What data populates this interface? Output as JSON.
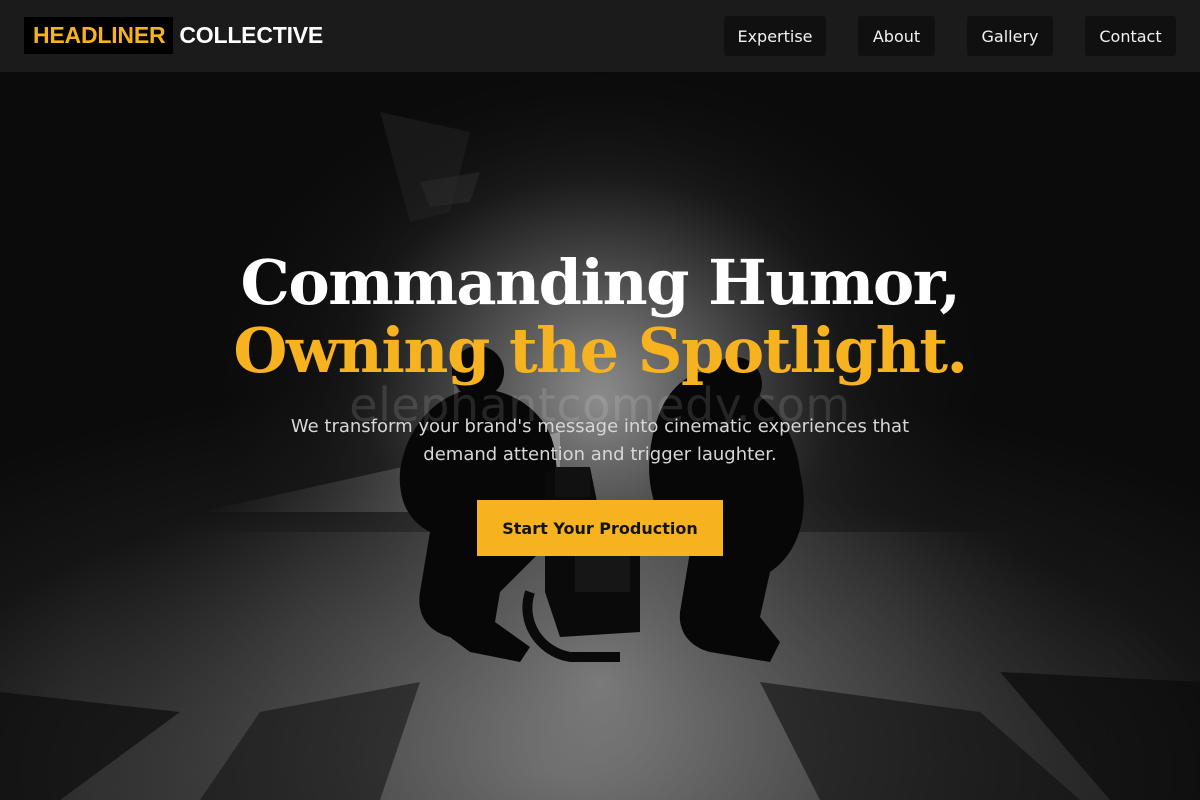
{
  "brand": {
    "primary": "HEADLINER",
    "secondary": "COLLECTIVE"
  },
  "nav": {
    "items": [
      {
        "label": "Expertise"
      },
      {
        "label": "About"
      },
      {
        "label": "Gallery"
      },
      {
        "label": "Contact"
      }
    ]
  },
  "hero": {
    "headline_line1": "Commanding Humor,",
    "headline_line2": "Owning the Spotlight.",
    "watermark": "elephantcomedy.com",
    "subcopy": "We transform your brand's message into cinematic experiences that demand attention and trigger laughter.",
    "cta_label": "Start Your Production",
    "background_description_icon": "film-crew-silhouette-image"
  },
  "colors": {
    "accent": "#f6b21f",
    "nav_bg": "#1b1b1b",
    "nav_button_bg": "#101010",
    "text_primary": "#ffffff",
    "text_secondary": "#d7d7d7"
  }
}
